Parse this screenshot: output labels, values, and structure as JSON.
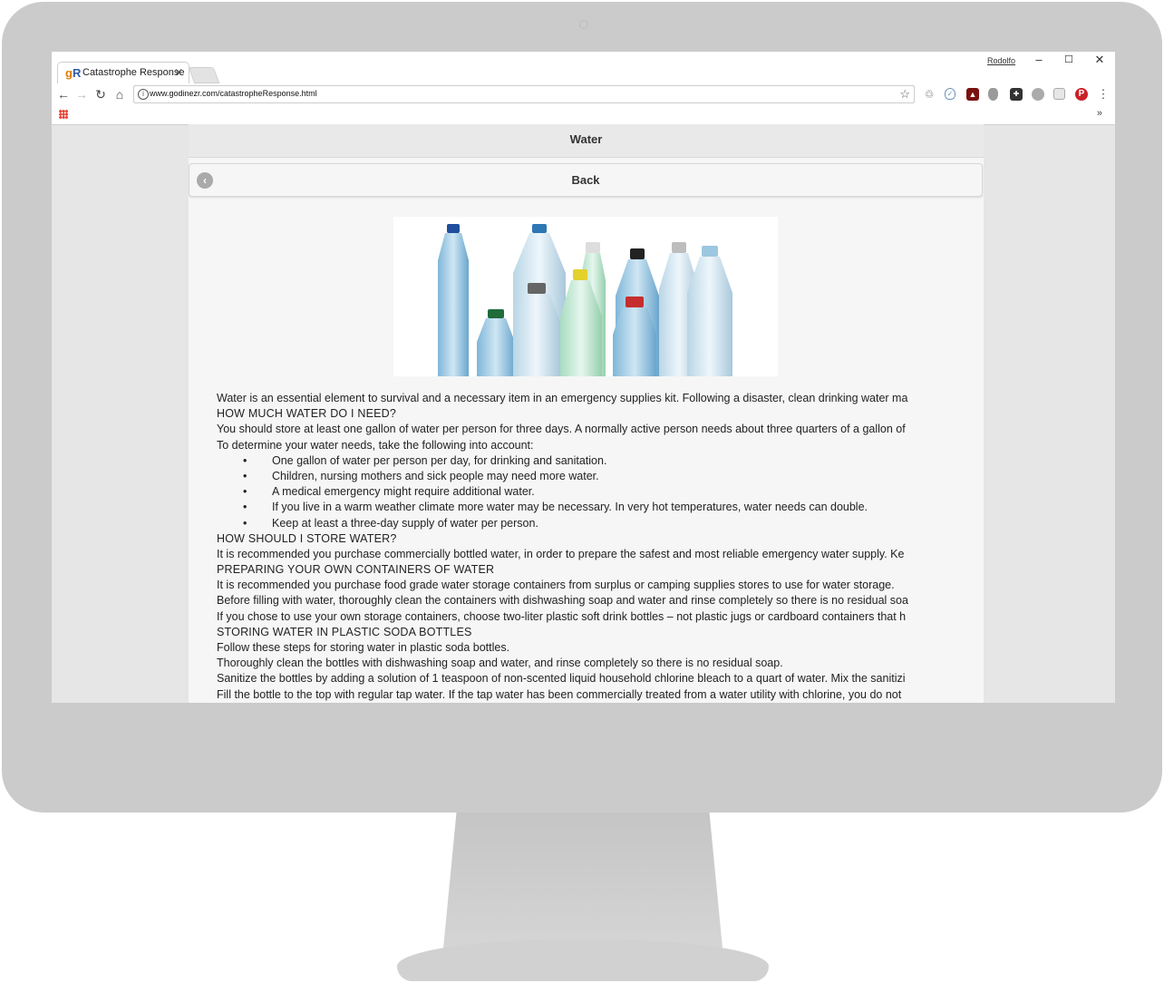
{
  "browser": {
    "tab_title": "Catastrophe Response",
    "tab_logo": "gR",
    "profile_name": "Rodolfo",
    "url": "www.godinezr.com/catastropheResponse.html"
  },
  "page": {
    "header_title": "Water",
    "back_label": "Back",
    "intro": "Water is an essential element to survival and a necessary item in an emergency supplies kit. Following a disaster, clean drinking water ma",
    "heading_1": "HOW MUCH WATER DO I NEED?",
    "para_1": "You should store at least one gallon of water per person for three days. A normally active person needs about three quarters of a gallon of",
    "para_2": "To determine your water needs, take the following into account:",
    "bullets": [
      "One gallon of water per person per day, for drinking and sanitation.",
      "Children, nursing mothers and sick people may need more water.",
      "A medical emergency might require additional water.",
      "If you live in a warm weather climate more water may be necessary. In very hot temperatures, water needs can double.",
      "Keep at least a three-day supply of water per person."
    ],
    "heading_2": "HOW SHOULD I STORE WATER?",
    "para_3": "It is recommended you purchase commercially bottled water, in order to prepare the safest and most reliable emergency water supply. Ke",
    "heading_3": "PREPARING YOUR OWN CONTAINERS OF WATER",
    "para_4": "It is recommended you purchase food grade water storage containers from surplus or camping supplies stores to use for water storage.",
    "para_5": "Before filling with water, thoroughly clean the containers with dishwashing soap and water and rinse completely so there is no residual soa",
    "para_6": "If you chose to use your own storage containers, choose two-liter plastic soft drink bottles – not plastic jugs or cardboard containers that h",
    "heading_4": "STORING WATER IN PLASTIC SODA BOTTLES",
    "para_7": "Follow these steps for storing water in plastic soda bottles.",
    "para_8": "Thoroughly clean the bottles with dishwashing soap and water, and rinse completely so there is no residual soap.",
    "para_9": "Sanitize the bottles by adding a solution of 1 teaspoon of non-scented liquid household chlorine bleach to a quart of water. Mix the sanitizi",
    "para_10": "Fill the bottle to the top with regular tap water. If the tap water has been commercially treated from a water utility with chlorine, you do not"
  },
  "colors": {
    "monitor_frame": "#cbcbcb",
    "page_bg": "#f6f6f6",
    "header_bg": "#e9e9e9",
    "text": "#222222"
  },
  "icons": [
    "back-arrow-icon",
    "forward-arrow-icon",
    "reload-icon",
    "home-icon",
    "info-icon",
    "star-icon",
    "recycle-icon",
    "shield-icon",
    "pdf-icon",
    "ghostery-icon",
    "puzzle-icon",
    "chat-icon",
    "cube-icon",
    "pinterest-icon",
    "menu-icon",
    "apps-icon",
    "chevron-icon",
    "back-circle-icon"
  ]
}
